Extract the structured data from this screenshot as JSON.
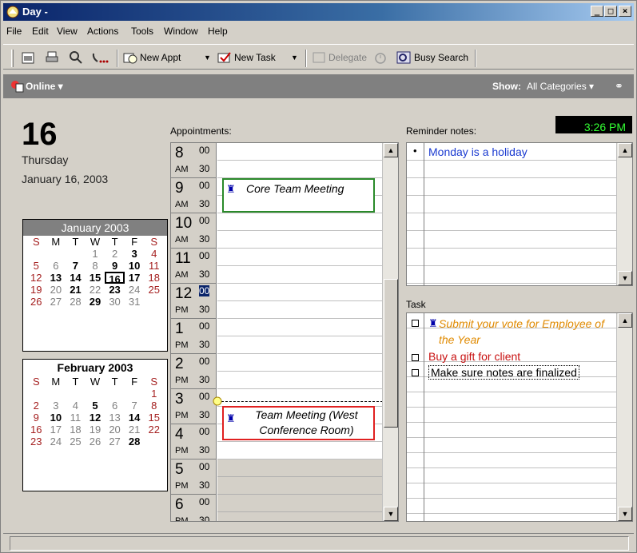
{
  "window": {
    "title": "Day -"
  },
  "menu": [
    "File",
    "Edit",
    "View",
    "Actions",
    "Tools",
    "Window",
    "Help"
  ],
  "toolbar": {
    "new_appt": "New Appt",
    "new_task": "New Task",
    "delegate": "Delegate",
    "busy_search": "Busy Search"
  },
  "statusbar_top": {
    "online": "Online",
    "show_label": "Show:",
    "show_value": "All Categories"
  },
  "day": {
    "number": "16",
    "weekday": "Thursday",
    "full_date": "January 16, 2003"
  },
  "cal1": {
    "title": "January 2003"
  },
  "cal2": {
    "title": "February 2003"
  },
  "weekday_headers": [
    "S",
    "M",
    "T",
    "W",
    "T",
    "F",
    "S"
  ],
  "appointments_label": "Appointments:",
  "time_slots": [
    {
      "hour": "8",
      "ampm": "AM"
    },
    {
      "hour": "9",
      "ampm": "AM"
    },
    {
      "hour": "10",
      "ampm": "AM"
    },
    {
      "hour": "11",
      "ampm": "AM"
    },
    {
      "hour": "12",
      "ampm": "PM"
    },
    {
      "hour": "1",
      "ampm": "PM"
    },
    {
      "hour": "2",
      "ampm": "PM"
    },
    {
      "hour": "3",
      "ampm": "PM"
    },
    {
      "hour": "4",
      "ampm": "PM"
    },
    {
      "hour": "5",
      "ampm": "PM"
    },
    {
      "hour": "6",
      "ampm": "PM"
    }
  ],
  "minutes": {
    "m00": "00",
    "m30": "30"
  },
  "appointments": [
    {
      "title": "Core Team Meeting",
      "border": "#2a8a2a"
    },
    {
      "title": "Team Meeting (West Conference Room)",
      "border": "#e02020"
    }
  ],
  "current_time": "3:26 PM",
  "reminder_label": "Reminder notes:",
  "reminders": [
    "Monday is a holiday"
  ],
  "task_label": "Task",
  "tasks": [
    {
      "text": "Submit your vote for Employee of the Year",
      "color": "#e08a00"
    },
    {
      "text": "Buy a gift for client",
      "color": "#c81010"
    },
    {
      "text": "Make sure notes are finalized",
      "color": "#000000"
    }
  ]
}
